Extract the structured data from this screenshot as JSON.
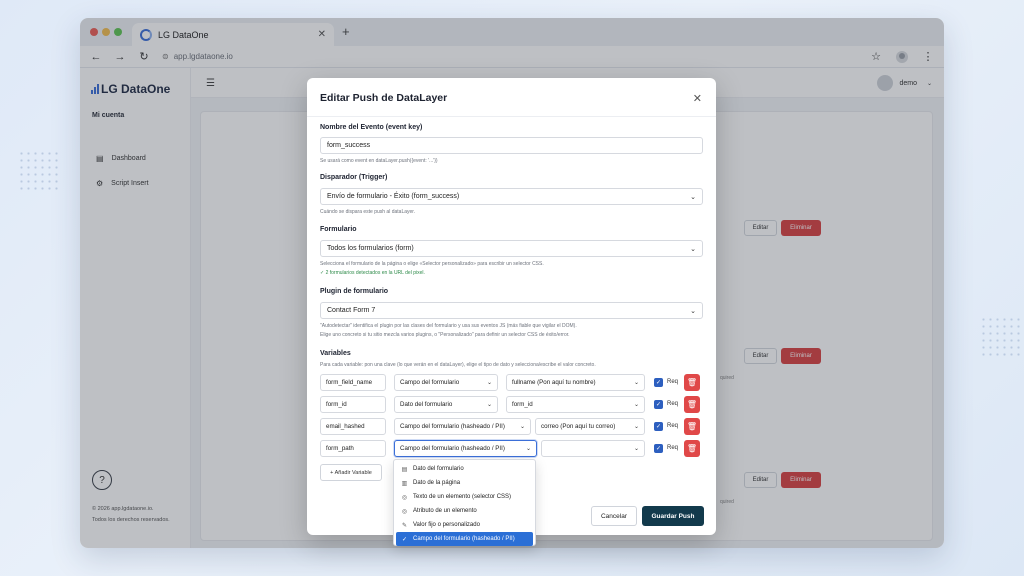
{
  "browser": {
    "tab_title": "LG DataOne",
    "url": "app.lgdataone.io"
  },
  "sidebar": {
    "brand": "LG DataOne",
    "section_title": "Mi cuenta",
    "items": [
      {
        "label": "Dashboard",
        "icon": "table-icon"
      },
      {
        "label": "Script Insert",
        "icon": "gear-icon"
      }
    ],
    "footer_line1": "© 2026 app.lgdataone.io.",
    "footer_line2": "Todos los derechos reservados."
  },
  "topbar": {
    "user_name": "demo"
  },
  "background": {
    "edit_label": "Editar",
    "delete_label": "Eliminar",
    "required_label": "quired"
  },
  "modal": {
    "title": "Editar Push de DataLayer",
    "event_label": "Nombre del Evento (event key)",
    "event_value": "form_success",
    "event_help": "Se usará como event en dataLayer.push({event: '...'})",
    "trigger_label": "Disparador (Trigger)",
    "trigger_value": "Envío de formulario - Éxito (form_success)",
    "trigger_help": "Cuándo se dispara este push al dataLayer.",
    "form_label": "Formulario",
    "form_value": "Todos los formularios (form)",
    "form_help": "Selecciona el formulario de la página o elige «Selector personalizado» para escribir un selector CSS.",
    "form_detected": "✓ 2 formularios detectados en la URL del pixel.",
    "plugin_label": "Plugin de formulario",
    "plugin_value": "Contact Form 7",
    "plugin_help1": "\"Autodetectar\" identifica el plugin por las clases del formulario y usa sus eventos JS (más fiable que vigilar el DOM).",
    "plugin_help2": "Elige uno concreto si tu sitio mezcla varios plugins, o \"Personalizado\" para definir un selector CSS de éxito/error.",
    "variables_label": "Variables",
    "variables_help": "Para cada variable: pon una clave (lo que verán en el dataLayer), elige el tipo de dato y selecciona/escribe el valor concreto.",
    "req_label": "Req",
    "variables": [
      {
        "key": "form_field_name",
        "type": "Campo del formulario",
        "value": "fullname (Pon aquí tu nombre)"
      },
      {
        "key": "form_id",
        "type": "Dato del formulario",
        "value": "form_id"
      },
      {
        "key": "email_hashed",
        "type": "Campo del formulario (hasheado / PII)",
        "value": "correo (Pon aquí tu correo)"
      },
      {
        "key": "form_path",
        "type": "Campo del formulario (hasheado / PII)",
        "value": ""
      }
    ],
    "add_variable": "+ Añadir Variable",
    "cancel": "Cancelar",
    "save": "Guardar Push"
  },
  "dropdown": {
    "options": [
      {
        "label": "Dato del formulario",
        "icon": "document-icon"
      },
      {
        "label": "Dato de la página",
        "icon": "page-icon"
      },
      {
        "label": "Texto de un elemento (selector CSS)",
        "icon": "target-icon"
      },
      {
        "label": "Atributo de un elemento",
        "icon": "target-icon"
      },
      {
        "label": "Valor fijo o personalizado",
        "icon": "pencil-icon"
      },
      {
        "label": "Campo del formulario (hasheado / PII)",
        "icon": "check-icon"
      }
    ],
    "selected_index": 5
  },
  "colors": {
    "accent": "#2b6fd6",
    "danger": "#e04848",
    "primary_dark": "#123a4c",
    "success": "#2e8b4a"
  }
}
